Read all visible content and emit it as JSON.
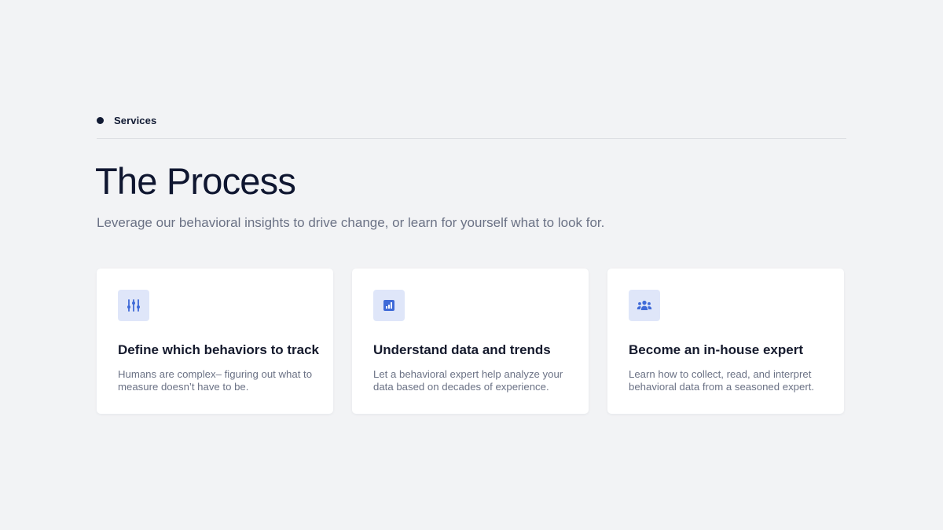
{
  "colors": {
    "background": "#f2f3f5",
    "accent": "#3f6ad8",
    "icon_bg": "#dfe6f9",
    "heading": "#0f1630",
    "muted": "#6b7285"
  },
  "section": {
    "eyebrow": "Services",
    "title": "The Process",
    "subtitle": "Leverage our behavioral insights to drive change, or learn for yourself what to look for."
  },
  "cards": [
    {
      "icon": "sliders-icon",
      "title": "Define which behaviors to track",
      "text": "Humans are complex– figuring out what to measure doesn’t have to be."
    },
    {
      "icon": "bar-chart-icon",
      "title": "Understand data and trends",
      "text": "Let a behavioral expert help analyze your data based on decades of experience."
    },
    {
      "icon": "users-icon",
      "title": "Become an in-house expert",
      "text": "Learn how to collect, read, and interpret behavioral data from a seasoned expert."
    }
  ]
}
